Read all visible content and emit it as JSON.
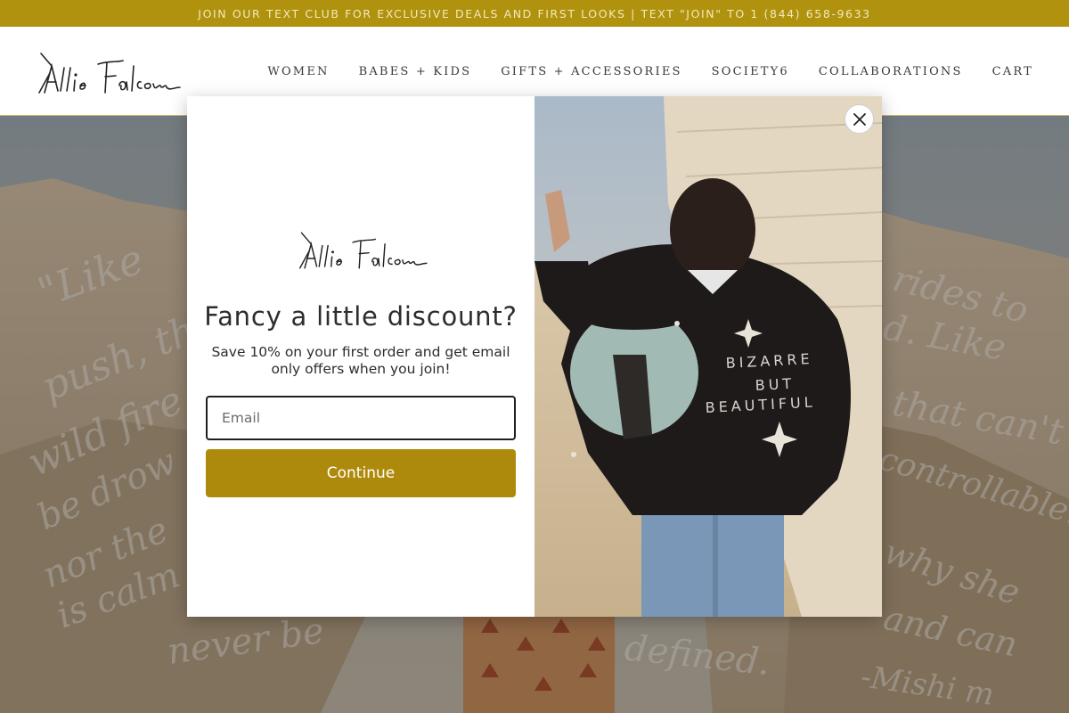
{
  "announcement": {
    "text": "JOIN OUR TEXT CLUB FOR EXCLUSIVE DEALS AND FIRST LOOKS | TEXT \"JOIN\" TO 1 (844) 658-9633"
  },
  "header": {
    "logo_text": "Allie Falcon",
    "nav": [
      {
        "label": "WOMEN"
      },
      {
        "label": "BABES + KIDS"
      },
      {
        "label": "GIFTS + ACCESSORIES"
      },
      {
        "label": "SOCIETY6"
      },
      {
        "label": "COLLABORATIONS"
      },
      {
        "label": "CART"
      }
    ]
  },
  "hero": {
    "script_lines": [
      "\"Like",
      "push, th",
      "wild fire",
      "be drow",
      "nor the",
      "is calm",
      "never be",
      "rides to",
      "d. Like",
      "that can't",
      "controllable.",
      "why she",
      "and can",
      "defined.",
      "-Mishi m"
    ]
  },
  "modal": {
    "logo_text": "Allie Falcon",
    "headline": "Fancy a little discount?",
    "subtext": "Save 10% on your first order and get email only offers when you join!",
    "email": {
      "placeholder": "Email",
      "value": ""
    },
    "continue_label": "Continue",
    "close_icon": "close-icon",
    "sweater_text": [
      "BIZARRE",
      "BUT",
      "BEAUTIFUL"
    ]
  },
  "colors": {
    "announcement_bg": "#b0920f",
    "button_bg": "#ae8a0c",
    "header_border": "#c9b86a"
  }
}
